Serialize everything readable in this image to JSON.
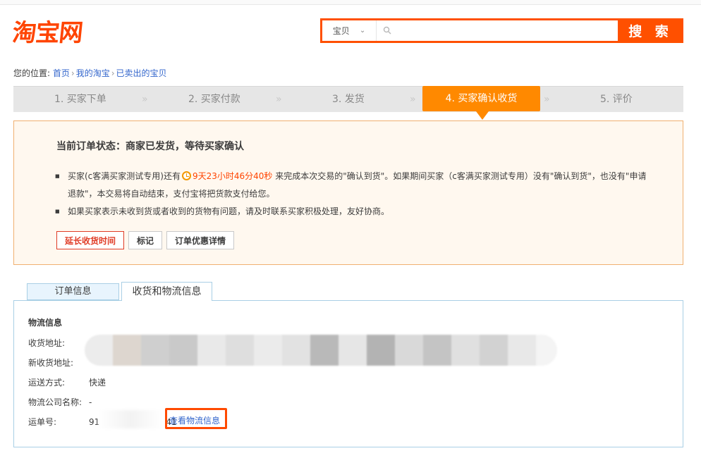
{
  "logo": {
    "text": "淘宝网"
  },
  "search": {
    "category": "宝贝",
    "button": "搜 索",
    "placeholder": ""
  },
  "breadcrumb": {
    "prefix": "您的位置:",
    "items": [
      "首页",
      "我的淘宝",
      "已卖出的宝贝"
    ],
    "separator": "›"
  },
  "steps": [
    {
      "label": "1. 买家下单"
    },
    {
      "label": "2. 买家付款"
    },
    {
      "label": "3. 发货"
    },
    {
      "label": "4. 买家确认收货",
      "active": true
    },
    {
      "label": "5. 评价"
    }
  ],
  "step_arrow": "»",
  "status": {
    "title": "当前订单状态：商家已发货，等待买家确认",
    "line1_a": "买家(c客满买家测试专用)还有",
    "countdown": "9天23小时46分40秒",
    "line1_b": "来完成本次交易的\"确认到货\"。如果期间买家（c客满买家测试专用）没有\"确认到货\"，也没有\"申请退款\"，本交易将自动结束，支付宝将把货款支付给您。",
    "line2": "如果买家表示未收到货或者收到的货物有问题，请及时联系买家积极处理，友好协商。",
    "buttons": {
      "extend": "延长收货时间",
      "mark": "标记",
      "discount": "订单优惠详情"
    }
  },
  "tabs": [
    "订单信息",
    "收货和物流信息"
  ],
  "logistics": {
    "section_title": "物流信息",
    "address_label": "收货地址:",
    "new_address_label": "新收货地址:",
    "shipping_method_label": "运送方式:",
    "shipping_method": "快递",
    "company_label": "物流公司名称:",
    "company": "-",
    "tracking_label": "运单号:",
    "tracking_prefix": "91",
    "tracking_suffix": "41",
    "view_link": "查看物流信息"
  },
  "colors": {
    "brand": "#ff4400",
    "step_active": "#ff8900",
    "link": "#3366cc",
    "highlight": "#ff4a00"
  }
}
